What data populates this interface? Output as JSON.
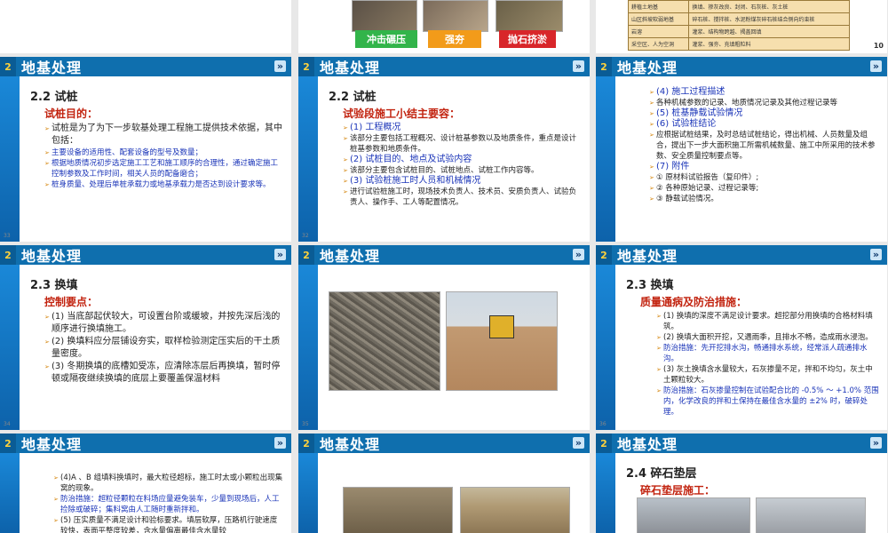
{
  "header_title": "地基处理",
  "header_num": "2",
  "tags": [
    "冲击碾压",
    "强夯",
    "抛石挤淤"
  ],
  "table_rows": [
    [
      "耕植土地基",
      "换填、掺灰改良、封闭、石灰桩、灰土桩"
    ],
    [
      "山区斜坡软弱地基",
      "碎石桩、搅拌桩、水泥粉煤灰碎石桩结合侧向约束桩"
    ],
    [
      "岩溶",
      "灌浆、结构物跨越、揭盖回填"
    ],
    [
      "采空区、人为空洞",
      "灌浆、强夯、充填粗粒料"
    ]
  ],
  "page_ten": "10",
  "s32": {
    "sec": "2.2  试桩",
    "sub": "试桩目的：",
    "items": [
      "试桩是为了为下一步软基处理工程施工提供技术依据，其中包括：",
      "主要设备的适用性、配套设备的型号及数量；",
      "根据地质情况初步选定施工工艺和施工顺序的合理性，通过确定施工控制参数及工作时间，相关人员的配备磨合；",
      "桩身质量、处理后单桩承载力或地基承载力是否达到设计要求等。"
    ],
    "pg": "33"
  },
  "s33": {
    "sec": "2.2  试桩",
    "sub": "试验段施工小结主要容：",
    "items": [
      "(1) 工程概况",
      "该部分主要包括工程概况、设计桩基参数以及地质条件，重点是设计桩基参数和地质条件。",
      "(2) 试桩目的、地点及试验内容",
      "该部分主要包含试桩目的、试桩地点、试桩工作内容等。",
      "(3) 试验桩施工时人员和机械情况",
      "进行试验桩施工时，现场技术负责人、技术员、安质负责人、试验负责人、操作手、工人等配置情况。"
    ],
    "pg": "32"
  },
  "s34": {
    "items": [
      "(4) 施工过程描述",
      "各种机械参数的记录、地质情况记录及其他过程记录等",
      "(5) 桩基静载试验情况",
      "(6) 试验桩结论",
      "应根据试桩结果，及时总结试桩结论，得出机械、人员数量及组合，提出下一步大面积施工所需机械数量、施工中所采用的技术参数、安全质量控制要点等。",
      "(7) 附件",
      "① 原材料试验报告（复印件）;",
      "② 各种原始记录、过程记录等;",
      "③ 静载试验情况。"
    ]
  },
  "s35": {
    "sec": "2.3  换填",
    "sub": "控制要点：",
    "items": [
      "(1) 当底部起伏较大，可设置台阶或缓坡，并按先深后浅的顺序进行换填施工。",
      "(2) 换填料应分层铺设夯实，取样检验测定压实后的干土质量密度。",
      "(3) 冬期换填的底槽如受冻，应清除冻层后再换填，暂时停顿或隔夜继续换填的底层上要覆盖保温材料"
    ],
    "pg": "34"
  },
  "s36": {
    "pg": "35"
  },
  "s37": {
    "sec": "2.3  换填",
    "sub": "质量通病及防治措施：",
    "items": [
      "(1) 换填的深度不满足设计要求。超挖部分用换填的合格材料填筑。",
      "(2) 换填大面积开挖，又遇雨季，且排水不畅，造成雨水浸泡。",
      "防治措施：先开挖排水沟，畅通排水系统，经常派人疏通排水沟。",
      "(3) 灰土换填含水量较大，石灰掺量不足，拌和不均匀，灰土中土颗粒较大。",
      "防治措施：石灰掺量控制在试验配合比的 -0.5% ～ +1.0% 范围内，化学改良的拌和土保持在最佳含水量的 ±2% 时，破碎处理。"
    ],
    "pg": "36"
  },
  "s38": {
    "items": [
      "(4)A 、B 组填料换填时，最大粒径超标，施工时太或小颗粒出现集窝的现象。",
      "防治措施：超粒径颗粒在料场应量避免装车，少量到现场后，人工捡除或破碎；集料窝由人工随时重新拌和。",
      "(5) 压实质量不满足设计和验标要求。填层软厚，压路机行驶速度较快，表面平整度较差，含水量偏离最佳含水量较"
    ]
  },
  "s40": {
    "sec": "2.4  碎石垫层",
    "sub": "碎石垫层施工："
  }
}
